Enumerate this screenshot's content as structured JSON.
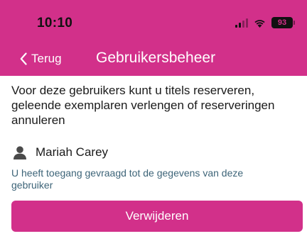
{
  "status_bar": {
    "time": "10:10",
    "battery": "93"
  },
  "navbar": {
    "back_label": "Terug",
    "title": "Gebruikersbeheer"
  },
  "intro_text": "Voor deze gebruikers kunt u titels reserveren, geleende exemplaren verlengen of reserveringen annuleren",
  "user": {
    "name": "Mariah Carey",
    "access_note": "U heeft toegang gevraagd tot de gegevens van deze gebruiker"
  },
  "remove_button_label": "Verwijderen",
  "colors": {
    "brand": "#d2308a",
    "note_text": "#3d6478"
  },
  "icons": {
    "back": "chevron-left-icon",
    "user": "person-icon",
    "signal": "cellular-signal-icon",
    "wifi": "wifi-icon",
    "battery": "battery-icon"
  }
}
